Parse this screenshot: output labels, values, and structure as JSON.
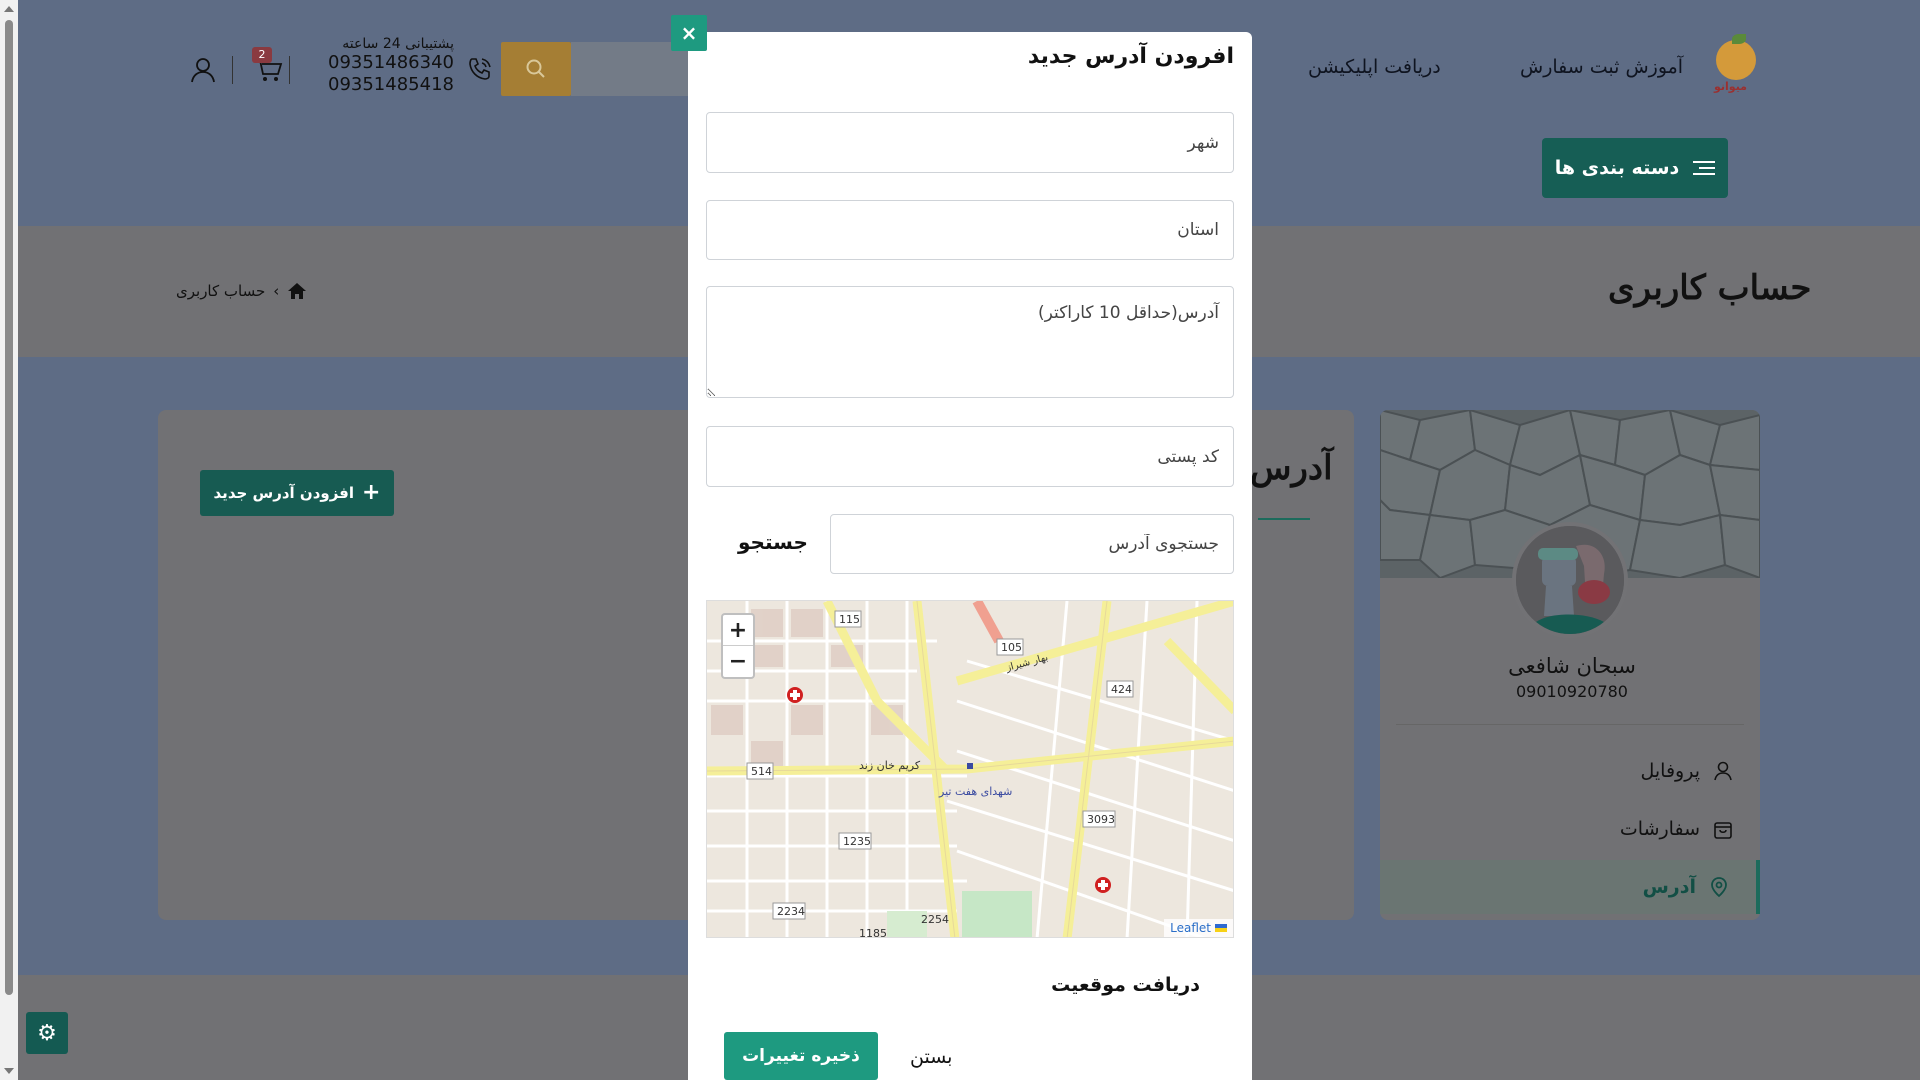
{
  "header": {
    "nav_order_guide": "آموزش ثبت سفارش",
    "nav_get_app": "دریافت اپلیکیشن",
    "support_label": "پشتیبانی 24 ساعته",
    "phone_1": "09351486340",
    "phone_2": "09351485418",
    "cart_count": "2",
    "logo_text": "میوانو",
    "categories_label": "دسته بندی ها"
  },
  "title_bar": {
    "page_title": "حساب کاربری",
    "breadcrumb_current": "حساب کاربری"
  },
  "main": {
    "section_title": "آدرس",
    "add_address_label": "افزودن آدرس جدید"
  },
  "sidebar": {
    "user_name": "سبحان شافعی",
    "user_phone": "09010920780",
    "items": [
      {
        "label": "پروفایل",
        "icon": "user-icon"
      },
      {
        "label": "سفارشات",
        "icon": "shopping-bag-icon"
      },
      {
        "label": "آدرس",
        "icon": "location-pin-icon",
        "active": true
      }
    ]
  },
  "modal": {
    "title": "افرودن آدرس جدید",
    "close_label": "×",
    "city_placeholder": "شهر",
    "state_placeholder": "استان",
    "address_placeholder": "آدرس(حداقل 10 کاراکتر)",
    "postal_placeholder": "کد پستی",
    "search_placeholder": "جستجوی آدرس",
    "search_label": "جستجو",
    "zoom_in": "+",
    "zoom_out": "−",
    "map_attribution": "Leaflet",
    "get_location_label": "دریافت موقعیت",
    "cancel_label": "بستن",
    "save_label": "ذخیره تغییرات"
  },
  "map_labels": {
    "road_115": "115",
    "road_105": "105",
    "road_424": "424",
    "road_514": "514",
    "road_3093": "3093",
    "road_1235": "1235",
    "road_2234": "2234",
    "road_2254": "2254",
    "road_1185": "1185",
    "street_karimkhan": "کریم خان زند",
    "station_name": "شهدای هفت تیر",
    "street_bahar": "بهار شیراز"
  },
  "colors": {
    "primary_green": "#1e9a80",
    "dark_green": "#165e55",
    "overlay_blue": "#5e6c85",
    "overlay_gray": "#717174"
  }
}
